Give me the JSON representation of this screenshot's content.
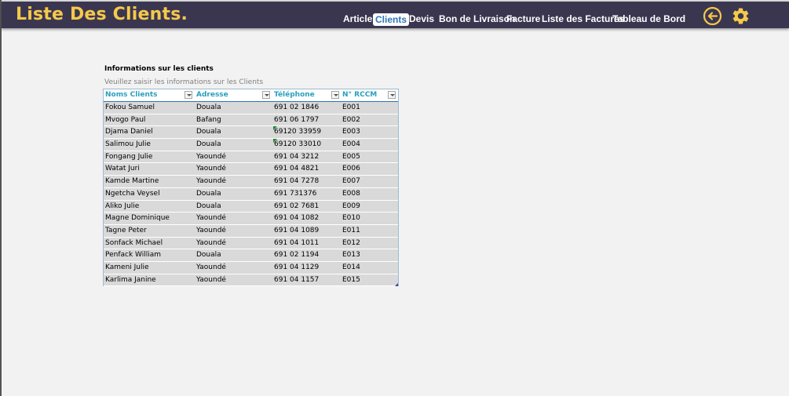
{
  "header": {
    "title": "Liste Des Clients.",
    "nav": [
      {
        "label": "Article",
        "active": false
      },
      {
        "label": "Clients",
        "active": true
      },
      {
        "label": "Devis",
        "active": false
      },
      {
        "label": "Bon de Livraison",
        "active": false
      },
      {
        "label": "Facture",
        "active": false
      },
      {
        "label": "Liste des Factures",
        "active": false
      },
      {
        "label": "Tableau de Bord",
        "active": false
      }
    ],
    "icons": [
      "back-arrow-icon",
      "gear-icon"
    ]
  },
  "section": {
    "title": "Informations sur  les clients",
    "subtitle": "Veuillez saisir les informations sur les Clients"
  },
  "table": {
    "columns": [
      "Noms Clients",
      "Adresse",
      "Téléphone",
      "N° RCCM"
    ],
    "rows": [
      [
        "Fokou Samuel",
        "Douala",
        "691 02 1846",
        "E001"
      ],
      [
        "Mvogo Paul",
        "Bafang",
        "691 06 1797",
        "E002"
      ],
      [
        "Djama Daniel",
        "Douala",
        "69120 33959",
        "E003"
      ],
      [
        "Salimou Julie",
        "Douala",
        "69120 33010",
        "E004"
      ],
      [
        "Fongang Julie",
        "Yaoundé",
        "691 04 3212",
        "E005"
      ],
      [
        "Watat Juri",
        "Yaoundé",
        "691 04 4821",
        "E006"
      ],
      [
        "Kamde Martine",
        "Yaoundé",
        "691 04 7278",
        "E007"
      ],
      [
        "Ngetcha Veysel",
        "Douala",
        "691  731376",
        "E008"
      ],
      [
        "Aliko Julie",
        "Douala",
        "691 02 7681",
        "E009"
      ],
      [
        "Magne Dominique",
        "Yaoundé",
        "691 04 1082",
        "E010"
      ],
      [
        "Tagne Peter",
        "Yaoundé",
        "691 04 1089",
        "E011"
      ],
      [
        "Sonfack Michael",
        "Yaoundé",
        "691 04 1011",
        "E012"
      ],
      [
        "Penfack William",
        "Douala",
        "691 02 1194",
        "E013"
      ],
      [
        "Kameni Julie",
        "Yaoundé",
        "691 04 1129",
        "E014"
      ],
      [
        "Karlima Janine",
        "Yaoundé",
        "691 04 1157",
        "E015"
      ]
    ],
    "text_number_flag_rows": [
      2,
      3
    ]
  },
  "colors": {
    "header_bg": "#3b3650",
    "title": "#f5c94a",
    "column_header_text": "#2a9fbc",
    "row_bg": "#d9d9d9",
    "active_tab_text": "#2e75b6"
  }
}
